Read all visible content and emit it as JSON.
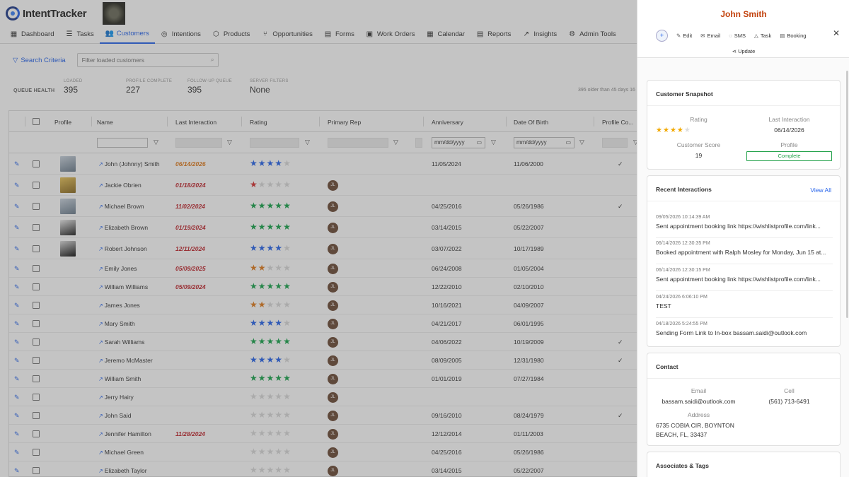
{
  "app": {
    "name": "IntentTracker"
  },
  "nav": [
    {
      "label": "Dashboard",
      "icon": "grid-icon",
      "glyph": "▦"
    },
    {
      "label": "Tasks",
      "icon": "list-icon",
      "glyph": "☰"
    },
    {
      "label": "Customers",
      "icon": "users-icon",
      "glyph": "👥",
      "active": true
    },
    {
      "label": "Intentions",
      "icon": "target-icon",
      "glyph": "◎"
    },
    {
      "label": "Products",
      "icon": "box-icon",
      "glyph": "⬡"
    },
    {
      "label": "Opportunities",
      "icon": "branch-icon",
      "glyph": "⑂"
    },
    {
      "label": "Forms",
      "icon": "document-icon",
      "glyph": "▤"
    },
    {
      "label": "Work Orders",
      "icon": "briefcase-icon",
      "glyph": "▣"
    },
    {
      "label": "Calendar",
      "icon": "calendar-icon",
      "glyph": "▦"
    },
    {
      "label": "Reports",
      "icon": "report-icon",
      "glyph": "▤"
    },
    {
      "label": "Insights",
      "icon": "chart-icon",
      "glyph": "↗"
    },
    {
      "label": "Admin Tools",
      "icon": "sliders-icon",
      "glyph": "⚙"
    }
  ],
  "search": {
    "button_label": "Search Criteria",
    "placeholder": "Filter loaded customers"
  },
  "queue_health": {
    "label": "QUEUE HEALTH",
    "stats": [
      {
        "label": "LOADED",
        "value": "395"
      },
      {
        "label": "PROFILE COMPLETE",
        "value": "227"
      },
      {
        "label": "FOLLOW-UP QUEUE",
        "value": "395"
      },
      {
        "label": "SERVER FILTERS",
        "value": "None"
      }
    ],
    "note": "395 older than 45 days   16"
  },
  "table": {
    "columns": [
      "Profile",
      "Name",
      "Last Interaction",
      "Rating",
      "Primary Rep",
      "Anniversary",
      "Date Of Birth",
      "Profile Co..."
    ],
    "date_placeholder": "mm/dd/yyyy",
    "rows": [
      {
        "name": "John (Johnny) Smith",
        "last": "06/14/2026",
        "last_color": "orange",
        "rating": 4,
        "star_color": "#2563eb",
        "rep": "",
        "anniv": "11/05/2024",
        "dob": "11/06/2000",
        "complete": true,
        "thumb": "t1"
      },
      {
        "name": "Jackie Obrien",
        "last": "01/18/2024",
        "last_color": "red",
        "rating": 1,
        "star_color": "#d62f2f",
        "rep": "JL",
        "anniv": "",
        "dob": "",
        "complete": false,
        "thumb": "t2"
      },
      {
        "name": "Michael Brown",
        "last": "11/02/2024",
        "last_color": "red",
        "rating": 5,
        "star_color": "#16a34a",
        "rep": "JL",
        "anniv": "04/25/2016",
        "dob": "05/26/1986",
        "complete": true,
        "thumb": "t1"
      },
      {
        "name": "Elizabeth Brown",
        "last": "01/19/2024",
        "last_color": "red",
        "rating": 5,
        "star_color": "#16a34a",
        "rep": "JL",
        "anniv": "03/14/2015",
        "dob": "05/22/2007",
        "complete": false,
        "thumb": "t3"
      },
      {
        "name": "Robert Johnson",
        "last": "12/11/2024",
        "last_color": "red",
        "rating": 4,
        "star_color": "#2563eb",
        "rep": "JL",
        "anniv": "03/07/2022",
        "dob": "10/17/1989",
        "complete": false,
        "thumb": "t4"
      },
      {
        "name": "Emily Jones",
        "last": "05/09/2025",
        "last_color": "red",
        "rating": 2,
        "star_color": "#e07b1b",
        "rep": "JL",
        "anniv": "06/24/2008",
        "dob": "01/05/2004",
        "complete": false,
        "thumb": ""
      },
      {
        "name": "William Williams",
        "last": "05/09/2024",
        "last_color": "red",
        "rating": 5,
        "star_color": "#16a34a",
        "rep": "JL",
        "anniv": "12/22/2010",
        "dob": "02/10/2010",
        "complete": false,
        "thumb": ""
      },
      {
        "name": "James Jones",
        "last": "",
        "last_color": "",
        "rating": 2,
        "star_color": "#e07b1b",
        "rep": "JL",
        "anniv": "10/16/2021",
        "dob": "04/09/2007",
        "complete": false,
        "thumb": ""
      },
      {
        "name": "Mary Smith",
        "last": "",
        "last_color": "",
        "rating": 4,
        "star_color": "#2563eb",
        "rep": "JL",
        "anniv": "04/21/2017",
        "dob": "06/01/1995",
        "complete": false,
        "thumb": ""
      },
      {
        "name": "Sarah Williams",
        "last": "",
        "last_color": "",
        "rating": 5,
        "star_color": "#16a34a",
        "rep": "JL",
        "anniv": "04/06/2022",
        "dob": "10/19/2009",
        "complete": true,
        "thumb": ""
      },
      {
        "name": "Jeremo McMaster",
        "last": "",
        "last_color": "",
        "rating": 4,
        "star_color": "#2563eb",
        "rep": "JL",
        "anniv": "08/09/2005",
        "dob": "12/31/1980",
        "complete": true,
        "thumb": ""
      },
      {
        "name": "William Smith",
        "last": "",
        "last_color": "",
        "rating": 5,
        "star_color": "#16a34a",
        "rep": "JL",
        "anniv": "01/01/2019",
        "dob": "07/27/1984",
        "complete": false,
        "thumb": ""
      },
      {
        "name": "Jerry Hairy",
        "last": "",
        "last_color": "",
        "rating": 0,
        "star_color": "#ccc",
        "rep": "JL",
        "anniv": "",
        "dob": "",
        "complete": false,
        "thumb": ""
      },
      {
        "name": "John Said",
        "last": "",
        "last_color": "",
        "rating": 0,
        "star_color": "#ccc",
        "rep": "JL",
        "anniv": "09/16/2010",
        "dob": "08/24/1979",
        "complete": true,
        "thumb": ""
      },
      {
        "name": "Jennifer Hamilton",
        "last": "11/28/2024",
        "last_color": "red",
        "rating": 0,
        "star_color": "#ccc",
        "rep": "JL",
        "anniv": "12/12/2014",
        "dob": "01/11/2003",
        "complete": false,
        "thumb": ""
      },
      {
        "name": "Michael Green",
        "last": "",
        "last_color": "",
        "rating": 0,
        "star_color": "#ccc",
        "rep": "JL",
        "anniv": "04/25/2016",
        "dob": "05/26/1986",
        "complete": false,
        "thumb": ""
      },
      {
        "name": "Elizabeth Taylor",
        "last": "",
        "last_color": "",
        "rating": 0,
        "star_color": "#ccc",
        "rep": "JL",
        "anniv": "03/14/2015",
        "dob": "05/22/2007",
        "complete": false,
        "thumb": ""
      }
    ]
  },
  "panel": {
    "title": "John Smith",
    "actions": [
      {
        "label": "Edit",
        "icon": "edit-icon",
        "glyph": "✎"
      },
      {
        "label": "Email",
        "icon": "mail-icon",
        "glyph": "✉"
      },
      {
        "label": "SMS",
        "icon": "chat-icon",
        "glyph": "◌"
      },
      {
        "label": "Task",
        "icon": "bell-icon",
        "glyph": "△"
      },
      {
        "label": "Booking",
        "icon": "calendar-icon",
        "glyph": "▤"
      }
    ],
    "update_label": "Update",
    "snapshot": {
      "title": "Customer Snapshot",
      "rating_label": "Rating",
      "rating": 4,
      "last_label": "Last Interaction",
      "last_value": "06/14/2026",
      "score_label": "Customer Score",
      "score_value": "19",
      "profile_label": "Profile",
      "profile_value": "Complete"
    },
    "interactions": {
      "title": "Recent Interactions",
      "view_all": "View All",
      "items": [
        {
          "ts": "09/05/2026 10:14:39 AM",
          "text": "Sent appointment booking link https://wishlistprofile.com/link..."
        },
        {
          "ts": "06/14/2026 12:30:35 PM",
          "text": "Booked appointment with Ralph Mosley for Monday, Jun 15 at..."
        },
        {
          "ts": "06/14/2026 12:30:15 PM",
          "text": "Sent appointment booking link https://wishlistprofile.com/link..."
        },
        {
          "ts": "04/24/2026 6:06:10 PM",
          "text": "TEST"
        },
        {
          "ts": "04/18/2026 5:24:55 PM",
          "text": "Sending Form Link to In-box bassam.saidi@outlook.com"
        }
      ]
    },
    "contact": {
      "title": "Contact",
      "email_label": "Email",
      "email": "bassam.saidi@outlook.com",
      "cell_label": "Cell",
      "cell": "(561) 713-6491",
      "address_label": "Address",
      "address": "6735 COBIA CIR, BOYNTON BEACH, FL, 33437"
    },
    "associates_title": "Associates & Tags"
  }
}
